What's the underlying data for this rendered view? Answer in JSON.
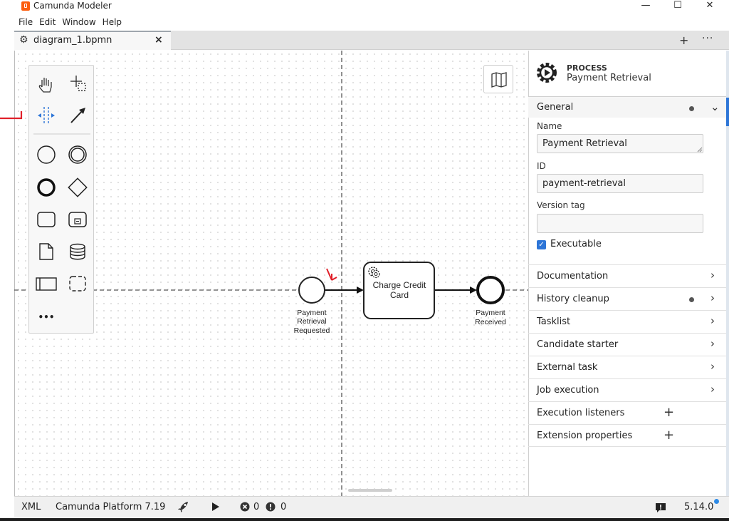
{
  "window": {
    "title": "Camunda Modeler",
    "controls": {
      "minimize": "—",
      "maximize": "☐",
      "close": "✕"
    }
  },
  "menu": [
    "File",
    "Edit",
    "Window",
    "Help"
  ],
  "tabs": [
    {
      "label": "diagram_1.bpmn",
      "icon": "gear-icon",
      "close": "×"
    }
  ],
  "tabbar": {
    "add": "+",
    "more": "···"
  },
  "diagram": {
    "start_event": {
      "label_lines": [
        "Payment",
        "Retrieval",
        "Requested"
      ]
    },
    "task": {
      "label_lines": [
        "Charge Credit",
        "Card"
      ],
      "icon": "service-task-gear-icon"
    },
    "end_event": {
      "label_lines": [
        "Payment",
        "Received"
      ]
    }
  },
  "palette": {
    "tools": [
      "hand-tool-icon",
      "lasso-tool-icon",
      "space-tool-icon",
      "global-connect-icon",
      "start-event-icon",
      "intermediate-event-icon",
      "end-event-icon",
      "gateway-icon",
      "task-icon",
      "subprocess-icon",
      "data-object-icon",
      "data-store-icon",
      "pool-icon",
      "group-icon",
      "more-icon"
    ],
    "more_label": "•••"
  },
  "properties": {
    "element_type": "PROCESS",
    "element_name": "Payment Retrieval",
    "general": {
      "title": "General",
      "name_label": "Name",
      "name_value": "Payment Retrieval",
      "id_label": "ID",
      "id_value": "payment-retrieval",
      "version_label": "Version tag",
      "version_value": "",
      "executable_label": "Executable",
      "executable_checked": true
    },
    "groups": [
      {
        "label": "Documentation",
        "dot": false,
        "action": "chevron"
      },
      {
        "label": "History cleanup",
        "dot": true,
        "action": "chevron"
      },
      {
        "label": "Tasklist",
        "dot": false,
        "action": "chevron"
      },
      {
        "label": "Candidate starter",
        "dot": false,
        "action": "chevron"
      },
      {
        "label": "External task",
        "dot": false,
        "action": "chevron"
      },
      {
        "label": "Job execution",
        "dot": false,
        "action": "chevron"
      },
      {
        "label": "Execution listeners",
        "dot": false,
        "action": "plus"
      },
      {
        "label": "Extension properties",
        "dot": false,
        "action": "plus"
      }
    ]
  },
  "statusbar": {
    "xml": "XML",
    "platform": "Camunda Platform 7.19",
    "errors": "0",
    "warnings": "0",
    "version": "5.14.0"
  },
  "colors": {
    "accent": "#2d75d7",
    "logo": "#fc5d0d",
    "annotation": "#e0202a"
  }
}
